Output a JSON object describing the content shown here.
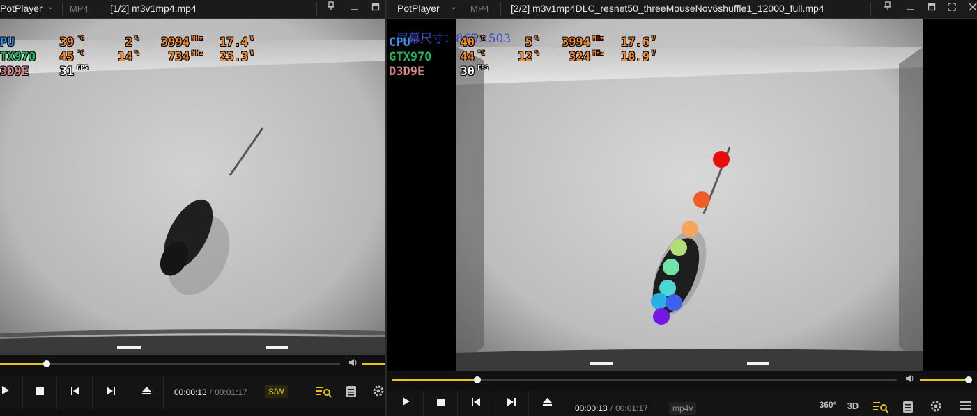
{
  "colors": {
    "accent": "#e2c51d",
    "osd_label_cpu": "#3a8fe6",
    "osd_label_gpu": "#27b35a",
    "osd_label_d3d": "#d9868a",
    "osd_value": "#f58a2b",
    "osd_fps": "#ffffff"
  },
  "players": [
    {
      "brand": "PotPlayer",
      "format": "MP4",
      "file": "[1/2] m3v1mp4.mp4",
      "osd": [
        {
          "label": "PU",
          "temp": "39",
          "temp_unit": "°C",
          "load": "2",
          "load_unit": "%",
          "clock": "3994",
          "clock_unit": "MHz",
          "volt": "17.4",
          "volt_unit": "V"
        },
        {
          "label": "TX970",
          "temp": "45",
          "temp_unit": "°C",
          "load": "14",
          "load_unit": "%",
          "clock": "734",
          "clock_unit": "MHz",
          "volt": "23.3",
          "volt_unit": "V"
        },
        {
          "label": "3D9E",
          "fps": "31",
          "fps_unit": "FPS"
        }
      ],
      "progress_fraction": 0.138,
      "time_current": "00:00:13",
      "time_total": "00:01:17",
      "codec_tag": "S/W",
      "icons": [
        "play-icon",
        "stop-icon",
        "previous-icon",
        "next-icon",
        "eject-icon",
        "playlist-search-icon",
        "list-icon",
        "gear-icon"
      ]
    },
    {
      "brand": "PotPlayer",
      "format": "MP4",
      "file": "[2/2] m3v1mp4DLC_resnet50_threeMouseNov6shuffle1_12000_full.mp4",
      "screen_size_label": "屏幕尺寸：865×503",
      "osd": [
        {
          "label": "CPU",
          "temp": "40",
          "temp_unit": "°C",
          "load": "5",
          "load_unit": "%",
          "clock": "3994",
          "clock_unit": "MHz",
          "volt": "17.6",
          "volt_unit": "V"
        },
        {
          "label": "GTX970",
          "temp": "44",
          "temp_unit": "°C",
          "load": "12",
          "load_unit": "%",
          "clock": "324",
          "clock_unit": "MHz",
          "volt": "18.9",
          "volt_unit": "V"
        },
        {
          "label": "D3D9E",
          "fps": "30",
          "fps_unit": "FPS"
        }
      ],
      "progress_fraction": 0.169,
      "time_current": "00:00:13",
      "time_total": "00:01:17",
      "codec_tag": "mp4v",
      "extra_buttons": {
        "vr": "360°",
        "stereo": "3D"
      },
      "keypoint_colors": [
        "#e80d0d",
        "#f25c27",
        "#f5a55c",
        "#b3dc7b",
        "#6fe3a8",
        "#4dd6d4",
        "#2aaee4",
        "#3a62ee",
        "#7516e8"
      ],
      "icons": [
        "play-icon",
        "stop-icon",
        "previous-icon",
        "next-icon",
        "eject-icon",
        "vr-360-icon",
        "3d-icon",
        "playlist-search-icon",
        "list-icon",
        "gear-icon",
        "menu-icon"
      ]
    }
  ]
}
